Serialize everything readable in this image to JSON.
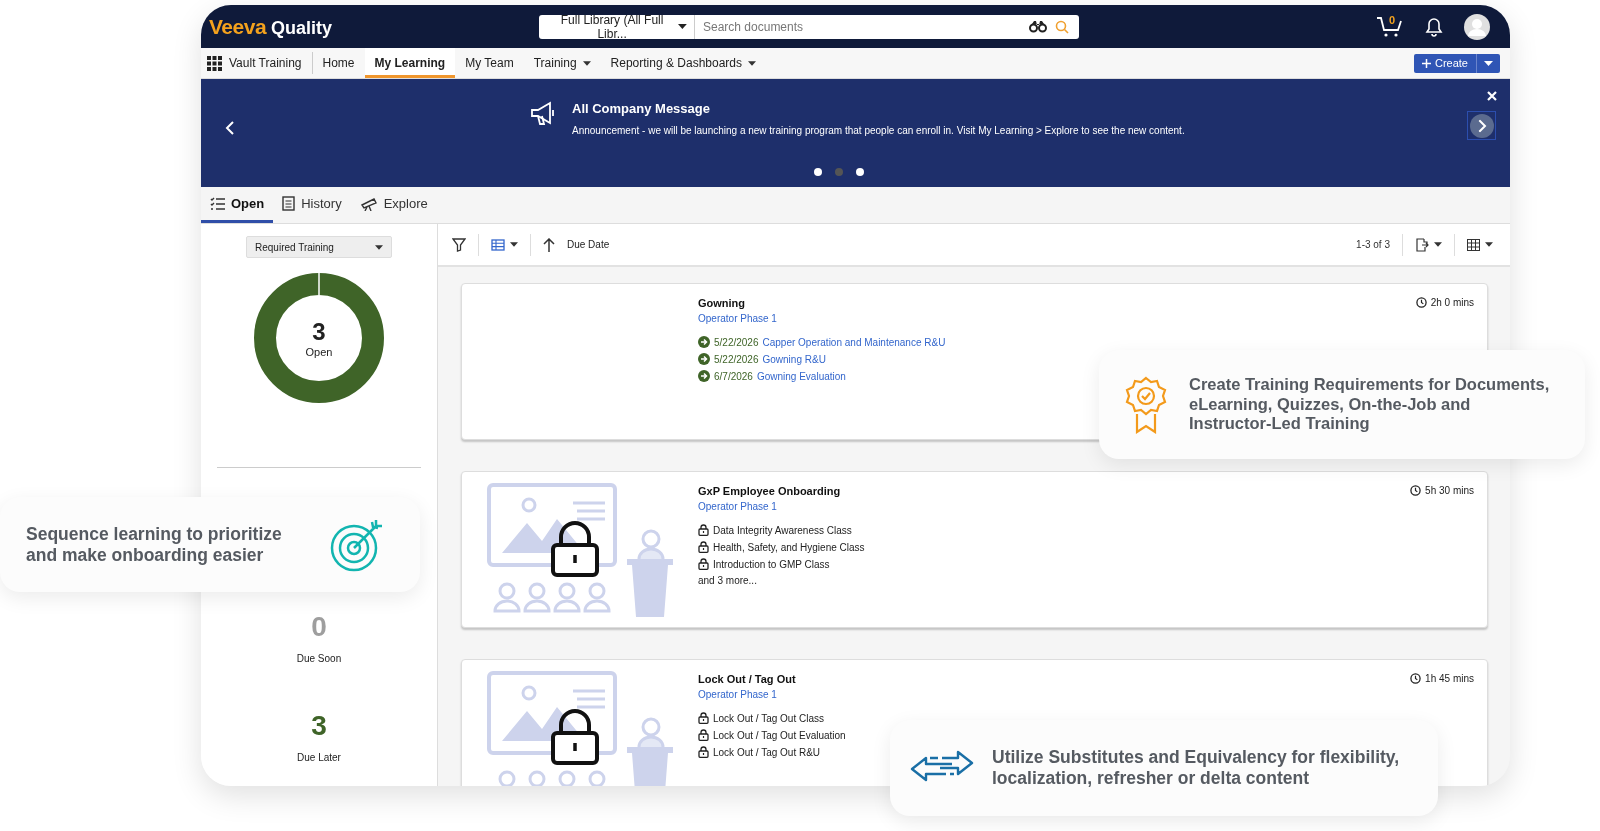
{
  "header": {
    "brand": "Veeva",
    "product": "Quality",
    "search_scope": "Full Library (All Full Libr...",
    "search_placeholder": "Search documents",
    "cart_count": "0"
  },
  "nav": {
    "app_name": "Vault Training",
    "items": [
      {
        "label": "Home",
        "selected": false,
        "dropdown": false
      },
      {
        "label": "My Learning",
        "selected": true,
        "dropdown": false
      },
      {
        "label": "My Team",
        "selected": false,
        "dropdown": false
      },
      {
        "label": "Training",
        "selected": false,
        "dropdown": true
      },
      {
        "label": "Reporting & Dashboards",
        "selected": false,
        "dropdown": true
      }
    ],
    "create_label": "Create"
  },
  "banner": {
    "title": "All Company Message",
    "message": "Announcement - we will be launching a new training program that people can enroll in. Visit My Learning > Explore to see the new content.",
    "dots": [
      {
        "selected": false
      },
      {
        "selected": true
      },
      {
        "selected": false
      }
    ]
  },
  "tabs": [
    {
      "label": "Open",
      "kind": "list",
      "selected": true
    },
    {
      "label": "History",
      "kind": "history",
      "selected": false
    },
    {
      "label": "Explore",
      "kind": "explore",
      "selected": false
    }
  ],
  "sidebar": {
    "filter": "Required Training",
    "donut_count": "3",
    "donut_label": "Open",
    "stats": [
      {
        "value": "0",
        "label": "Due Soon",
        "color": "#9e9e9e"
      },
      {
        "value": "3",
        "label": "Due Later",
        "color": "#3f6428"
      }
    ]
  },
  "toolbar": {
    "sort_label": "Due Date",
    "count": "1-3 of 3"
  },
  "courses": [
    {
      "title": "Gowning",
      "subtitle": "Operator Phase 1",
      "duration": "2h 0 mins",
      "has_image": false,
      "items": [
        {
          "kind": "date",
          "date": "5/22/2026",
          "label": "Capper Operation and Maintenance R&U"
        },
        {
          "kind": "date",
          "date": "5/22/2026",
          "label": "Gowning R&U"
        },
        {
          "kind": "date",
          "date": "6/7/2026",
          "label": "Gowning Evaluation"
        }
      ]
    },
    {
      "title": "GxP Employee Onboarding",
      "subtitle": "Operator Phase 1",
      "duration": "5h 30 mins",
      "has_image": true,
      "items": [
        {
          "kind": "locked",
          "label": "Data Integrity Awareness Class"
        },
        {
          "kind": "locked",
          "label": "Health, Safety, and Hygiene Class"
        },
        {
          "kind": "locked",
          "label": "Introduction to GMP Class"
        }
      ],
      "more": "and 3 more..."
    },
    {
      "title": "Lock Out / Tag Out",
      "subtitle": "Operator Phase 1",
      "duration": "1h 45 mins",
      "has_image": true,
      "items": [
        {
          "kind": "locked",
          "label": "Lock Out / Tag Out Class"
        },
        {
          "kind": "locked",
          "label": "Lock Out / Tag Out Evaluation"
        },
        {
          "kind": "locked",
          "label": "Lock Out / Tag Out R&U"
        }
      ]
    }
  ],
  "callouts": [
    {
      "kind": "target",
      "text": "Sequence learning to prioritize and make onboarding easier"
    },
    {
      "kind": "award",
      "text": "Create Training Requirements for Documents, eLearning, Quizzes, On-the-Job and Instructor-Led Training"
    },
    {
      "kind": "arrows",
      "text": "Utilize Substitutes and Equivalency for flexibility, localization, refresher or delta content"
    }
  ]
}
